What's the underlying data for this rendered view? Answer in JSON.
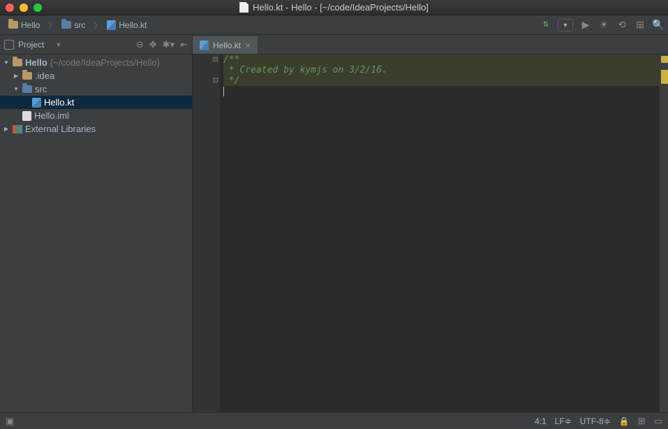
{
  "window": {
    "title": "Hello.kt - Hello - [~/code/IdeaProjects/Hello]"
  },
  "breadcrumbs": [
    {
      "label": "Hello",
      "icon": "folder"
    },
    {
      "label": "src",
      "icon": "folder-blue"
    },
    {
      "label": "Hello.kt",
      "icon": "kt"
    }
  ],
  "sidebar": {
    "header": {
      "label": "Project"
    },
    "tree": {
      "root": {
        "name": "Hello",
        "path": "(~/code/IdeaProjects/Hello)"
      },
      "idea": ".idea",
      "src": "src",
      "hello_kt": "Hello.kt",
      "hello_iml": "Hello.iml",
      "ext_lib": "External Libraries"
    }
  },
  "tabs": [
    {
      "label": "Hello.kt",
      "icon": "kt",
      "active": true
    }
  ],
  "code": {
    "l1": "/**",
    "l2": " * Created by kymjs on 3/2/16.",
    "l3": " */"
  },
  "status": {
    "pos": "4:1",
    "le": "LF≑",
    "enc": "UTF-8≑"
  },
  "colors": {
    "marker_warn": "#c9b043",
    "marker_warn2": "#cbb33f"
  }
}
